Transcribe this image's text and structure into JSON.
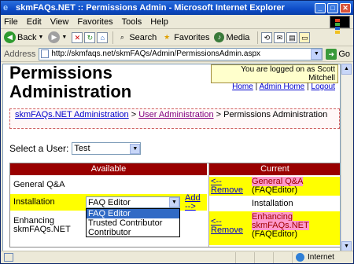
{
  "window": {
    "title": "skmFAQs.NET :: Permissions Admin - Microsoft Internet Explorer"
  },
  "menu": [
    "File",
    "Edit",
    "View",
    "Favorites",
    "Tools",
    "Help"
  ],
  "toolbar": {
    "back": "Back",
    "search": "Search",
    "favorites": "Favorites",
    "media": "Media"
  },
  "address": {
    "label": "Address",
    "url": "http://skmfaqs.net/skmFAQs/Admin/PermissionsAdmin.aspx",
    "go": "Go"
  },
  "page": {
    "title_line1": "Permissions",
    "title_line2": "Administration",
    "login_text": "You are logged on as Scott Mitchell",
    "links": {
      "home": "Home",
      "sep1": " | ",
      "admin_home": "Admin Home",
      "sep2": " | ",
      "logout": "Logout"
    },
    "breadcrumb": {
      "link1": "skmFAQs.NET Administration",
      "sep1": " > ",
      "link2": "User Administration",
      "sep2": " > ",
      "current": "Permissions Administration"
    },
    "select_user": {
      "label": "Select a User:",
      "value": "Test"
    },
    "table": {
      "available_header": "Available",
      "current_header": "Current",
      "available": [
        {
          "name": "General Q&A"
        },
        {
          "name": "Installation",
          "role_value": "FAQ Editor",
          "add_label": "Add -->"
        },
        {
          "name": "Enhancing skmFAQs.NET"
        }
      ],
      "role_options": [
        "FAQ Editor",
        "Trusted Contributor",
        "Contributor"
      ],
      "current": [
        {
          "remove": "<-- Remove",
          "name": "General Q&A",
          "role": "(FAQEditor)"
        },
        {
          "name": "Installation"
        },
        {
          "remove": "<-- Remove",
          "name": "Enhancing skmFAQs.NET",
          "role": "(FAQEditor)"
        }
      ]
    }
  },
  "status": {
    "zone": "Internet"
  }
}
